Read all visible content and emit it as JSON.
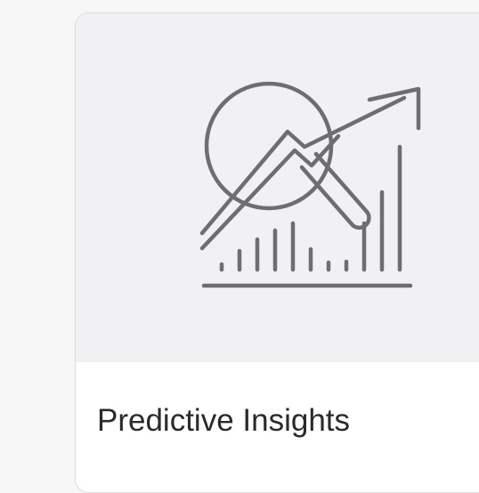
{
  "card": {
    "title": "Predictive Insights",
    "icon": "analytics-magnifier-chart-icon"
  },
  "colors": {
    "page_background": "#f6f6f6",
    "media_background": "#f1f0f2",
    "icon_stroke": "#6e6e70",
    "title_text": "#2a2a2a",
    "card_border": "#dcdcdc"
  }
}
